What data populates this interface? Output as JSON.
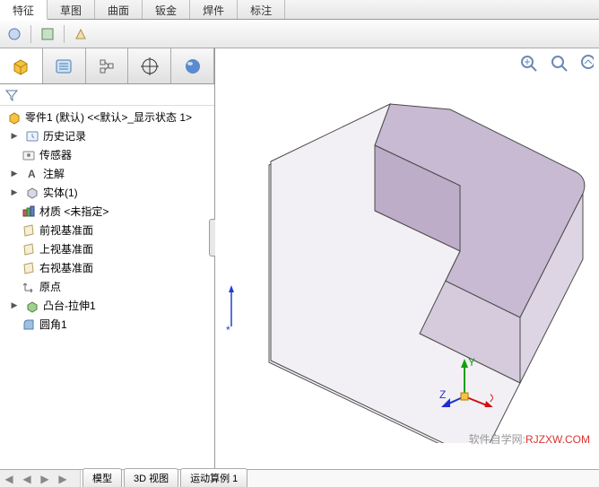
{
  "tabs": {
    "items": [
      "特征",
      "草图",
      "曲面",
      "钣金",
      "焊件",
      "标注"
    ],
    "active": 0
  },
  "tree": {
    "root": "零件1 (默认) <<默认>_显示状态 1>",
    "items": [
      {
        "label": "历史记录",
        "icon": "history",
        "expand": true
      },
      {
        "label": "传感器",
        "icon": "sensor",
        "expand": false
      },
      {
        "label": "注解",
        "icon": "annotation",
        "expand": true
      },
      {
        "label": "实体(1)",
        "icon": "solid",
        "expand": true
      },
      {
        "label": "材质 <未指定>",
        "icon": "material",
        "expand": false
      },
      {
        "label": "前视基准面",
        "icon": "plane",
        "expand": false
      },
      {
        "label": "上视基准面",
        "icon": "plane",
        "expand": false
      },
      {
        "label": "右视基准面",
        "icon": "plane",
        "expand": false
      },
      {
        "label": "原点",
        "icon": "origin",
        "expand": false
      },
      {
        "label": "凸台-拉伸1",
        "icon": "extrude",
        "expand": true
      },
      {
        "label": "圆角1",
        "icon": "fillet",
        "expand": false
      }
    ]
  },
  "bottom_tabs": [
    "模型",
    "3D 视图",
    "运动算例 1"
  ],
  "triad": {
    "x": "X",
    "y": "Y",
    "z": "Z"
  },
  "watermark": {
    "text": "软件自学网:",
    "url": "RJZXW.COM"
  }
}
